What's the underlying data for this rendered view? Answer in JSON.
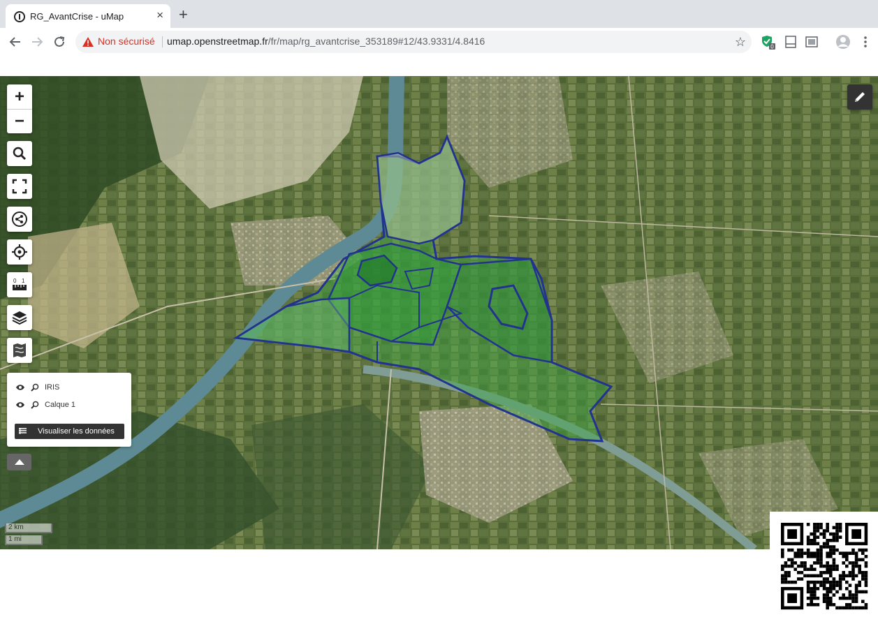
{
  "browser": {
    "tab_title": "RG_AvantCrise - uMap",
    "tab_close": "×",
    "new_tab": "+",
    "security_label": "Non sécurisé",
    "url_host": "umap.openstreetmap.fr",
    "url_path": "/fr/map/rg_avantcrise_353189#12/43.9331/4.8416",
    "bookmark_icon": "star-icon",
    "extension_badge": "0"
  },
  "map": {
    "zoom_in": "+",
    "zoom_out": "−",
    "controls": [
      "search-icon",
      "fullscreen-icon",
      "share-icon",
      "locate-icon",
      "measure-icon",
      "layers-icon",
      "map-style-icon"
    ],
    "edit_icon": "pencil-icon",
    "layers": [
      {
        "name": "IRIS"
      },
      {
        "name": "Calque 1"
      }
    ],
    "data_button": "Visualiser les données",
    "scale_km": "2 km",
    "scale_mi": "1 mi",
    "colors": {
      "zone_fill": "#3fa845",
      "zone_stroke": "#22338f",
      "river": "#5d8a94"
    }
  }
}
